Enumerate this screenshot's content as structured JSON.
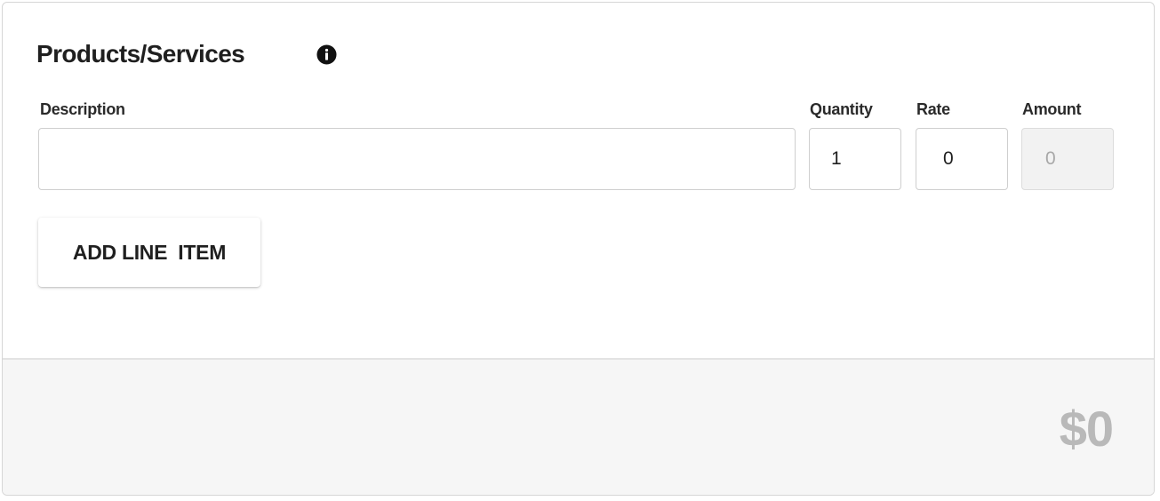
{
  "section": {
    "title": "Products/Services",
    "info_icon": "info-circle-icon"
  },
  "columns": {
    "description": "Description",
    "quantity": "Quantity",
    "rate": "Rate",
    "amount": "Amount"
  },
  "line_item": {
    "description": "",
    "quantity": "1",
    "rate": "0",
    "amount": "0"
  },
  "actions": {
    "add_line_item": "ADD LINE  ITEM"
  },
  "footer": {
    "total": "$0"
  }
}
